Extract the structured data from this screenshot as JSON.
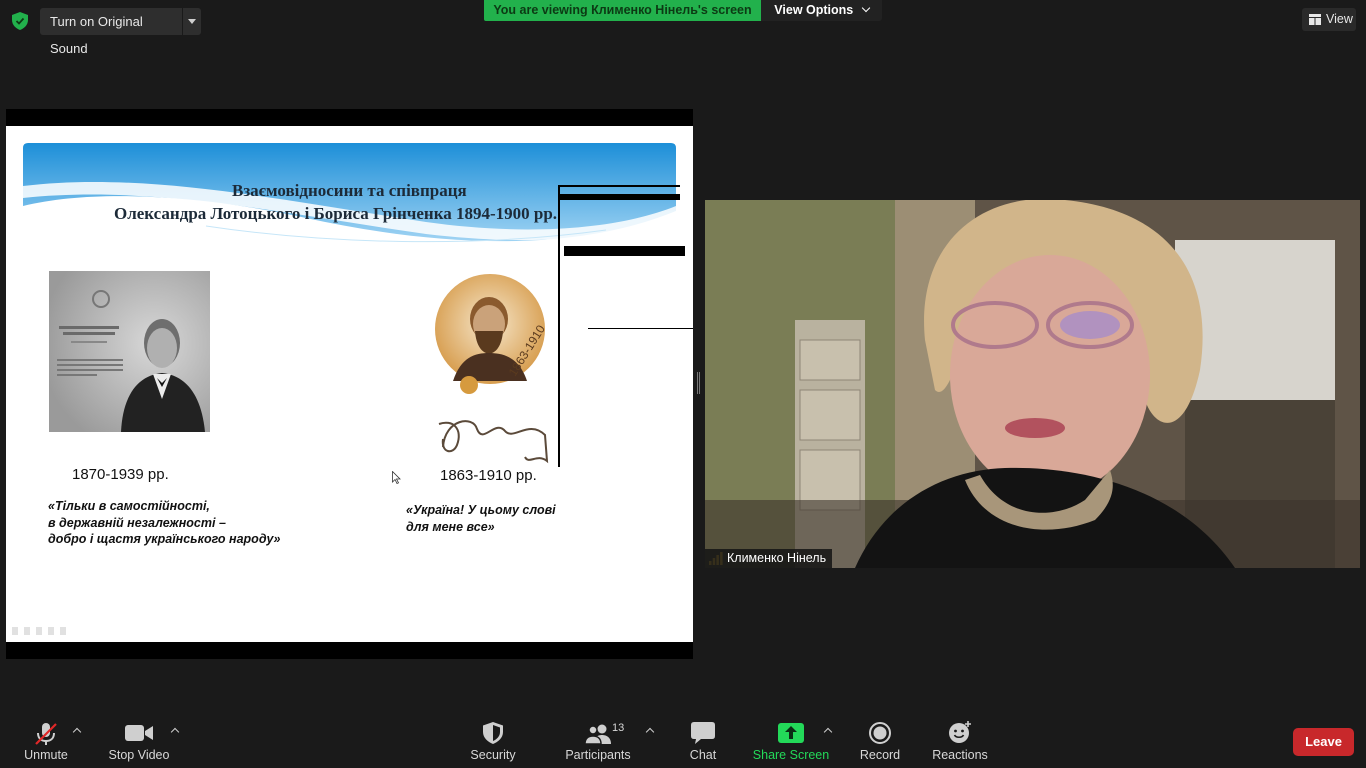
{
  "topbar": {
    "sound_button": "Turn on Original Sound",
    "viewing_banner": "You are viewing Клименко Нінель's screen",
    "view_options": "View Options",
    "view_button": "View"
  },
  "slide": {
    "title_line1": "Взаємовідносини та співпраця",
    "title_line2": "Олександра Лотоцького і Бориса Грінченка 1894-1900 рр.",
    "left_years": "1870-1939 рр.",
    "right_years": "1863-1910 рр.",
    "left_quote": [
      "«Тільки в самостійності,",
      "в державній незалежності –",
      "добро і щастя українського народу»"
    ],
    "right_quote": [
      "«Україна! У цьому слові",
      "для мене все»"
    ]
  },
  "speaker": {
    "name": "Клименко Нінель"
  },
  "toolbar": {
    "unmute": "Unmute",
    "stop_video": "Stop Video",
    "security": "Security",
    "participants": "Participants",
    "participants_count": "13",
    "chat": "Chat",
    "share_screen": "Share Screen",
    "record": "Record",
    "reactions": "Reactions",
    "leave": "Leave"
  },
  "colors": {
    "banner_green": "#22b14c",
    "leave_red": "#c8282b",
    "share_green": "#23d959"
  }
}
